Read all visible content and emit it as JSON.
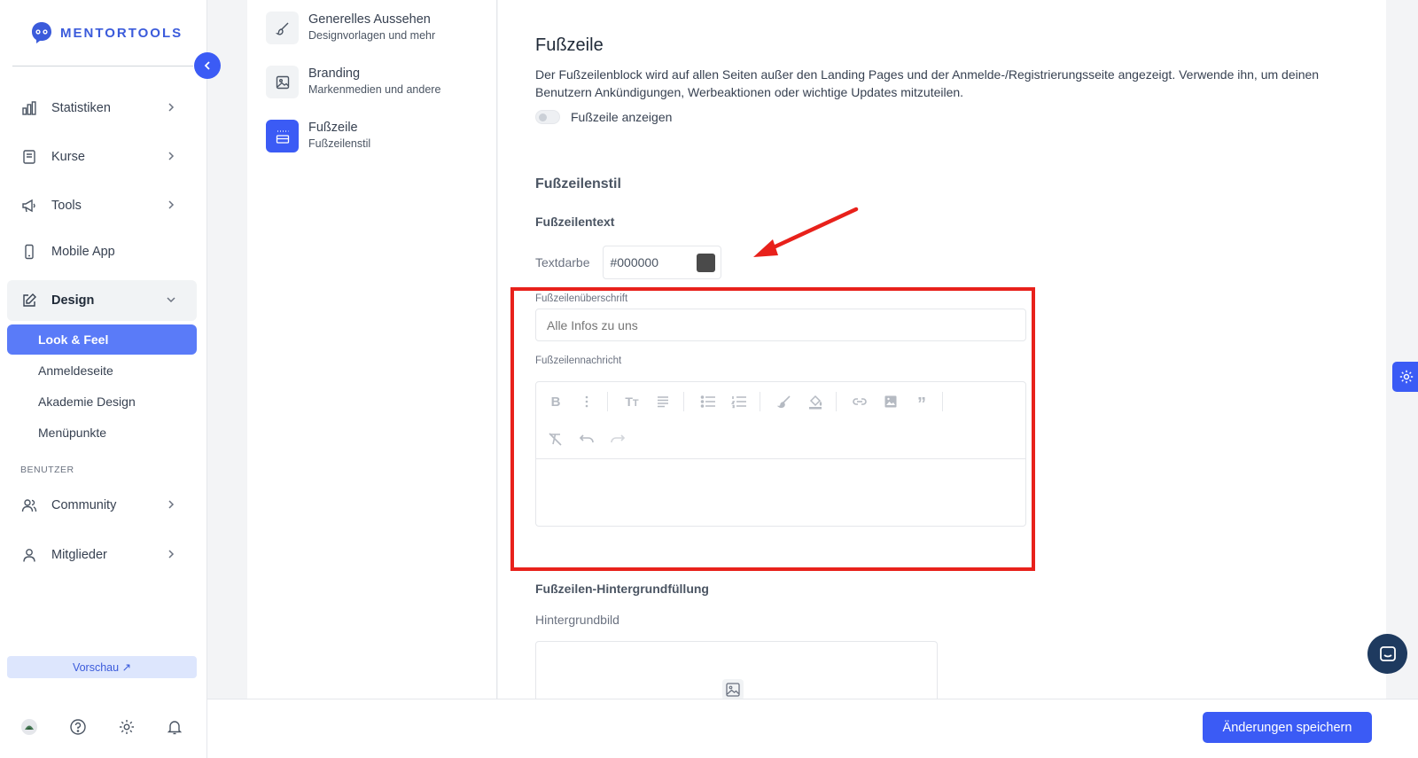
{
  "app": {
    "logo_text": "MENTORTOOLS",
    "accent_color": "#3b5bf5"
  },
  "sidebar": {
    "items": [
      {
        "label": "Statistiken",
        "icon": "bar-chart-icon"
      },
      {
        "label": "Kurse",
        "icon": "book-icon"
      },
      {
        "label": "Tools",
        "icon": "megaphone-icon"
      },
      {
        "label": "Mobile App",
        "icon": "mobile-icon"
      },
      {
        "label": "Design",
        "icon": "pencil-square-icon"
      }
    ],
    "design_subitems": [
      {
        "label": "Look & Feel"
      },
      {
        "label": "Anmeldeseite"
      },
      {
        "label": "Akademie Design"
      },
      {
        "label": "Menüpunkte"
      }
    ],
    "section_users": "BENUTZER",
    "user_items": [
      {
        "label": "Community",
        "icon": "users-icon"
      },
      {
        "label": "Mitglieder",
        "icon": "user-icon"
      }
    ],
    "preview_label": "Vorschau ↗"
  },
  "settings_nav": [
    {
      "title": "Generelles Aussehen",
      "subtitle": "Designvorlagen und mehr"
    },
    {
      "title": "Branding",
      "subtitle": "Markenmedien und andere"
    },
    {
      "title": "Fußzeile",
      "subtitle": "Fußzeilenstil"
    }
  ],
  "main": {
    "title": "Fußzeile",
    "description": "Der Fußzeilenblock wird auf allen Seiten außer den Landing Pages und der Anmelde-/Registrierungsseite angezeigt. Verwende ihn, um deinen Benutzern Ankündigungen, Werbeaktionen oder wichtige Updates mitzuteilen.",
    "toggle_label": "Fußzeile anzeigen",
    "style_heading": "Fußzeilenstil",
    "text_heading": "Fußzeilentext",
    "color_label": "Textdarbe",
    "color_value": "#000000",
    "heading_label": "Fußzeilenüberschrift",
    "heading_placeholder": "Alle Infos zu uns",
    "message_label": "Fußzeilennachricht",
    "bg_heading": "Fußzeilen-Hintergrundfüllung",
    "bg_image_label": "Hintergrundbild"
  },
  "save_bar": {
    "save_label": "Änderungen speichern"
  }
}
